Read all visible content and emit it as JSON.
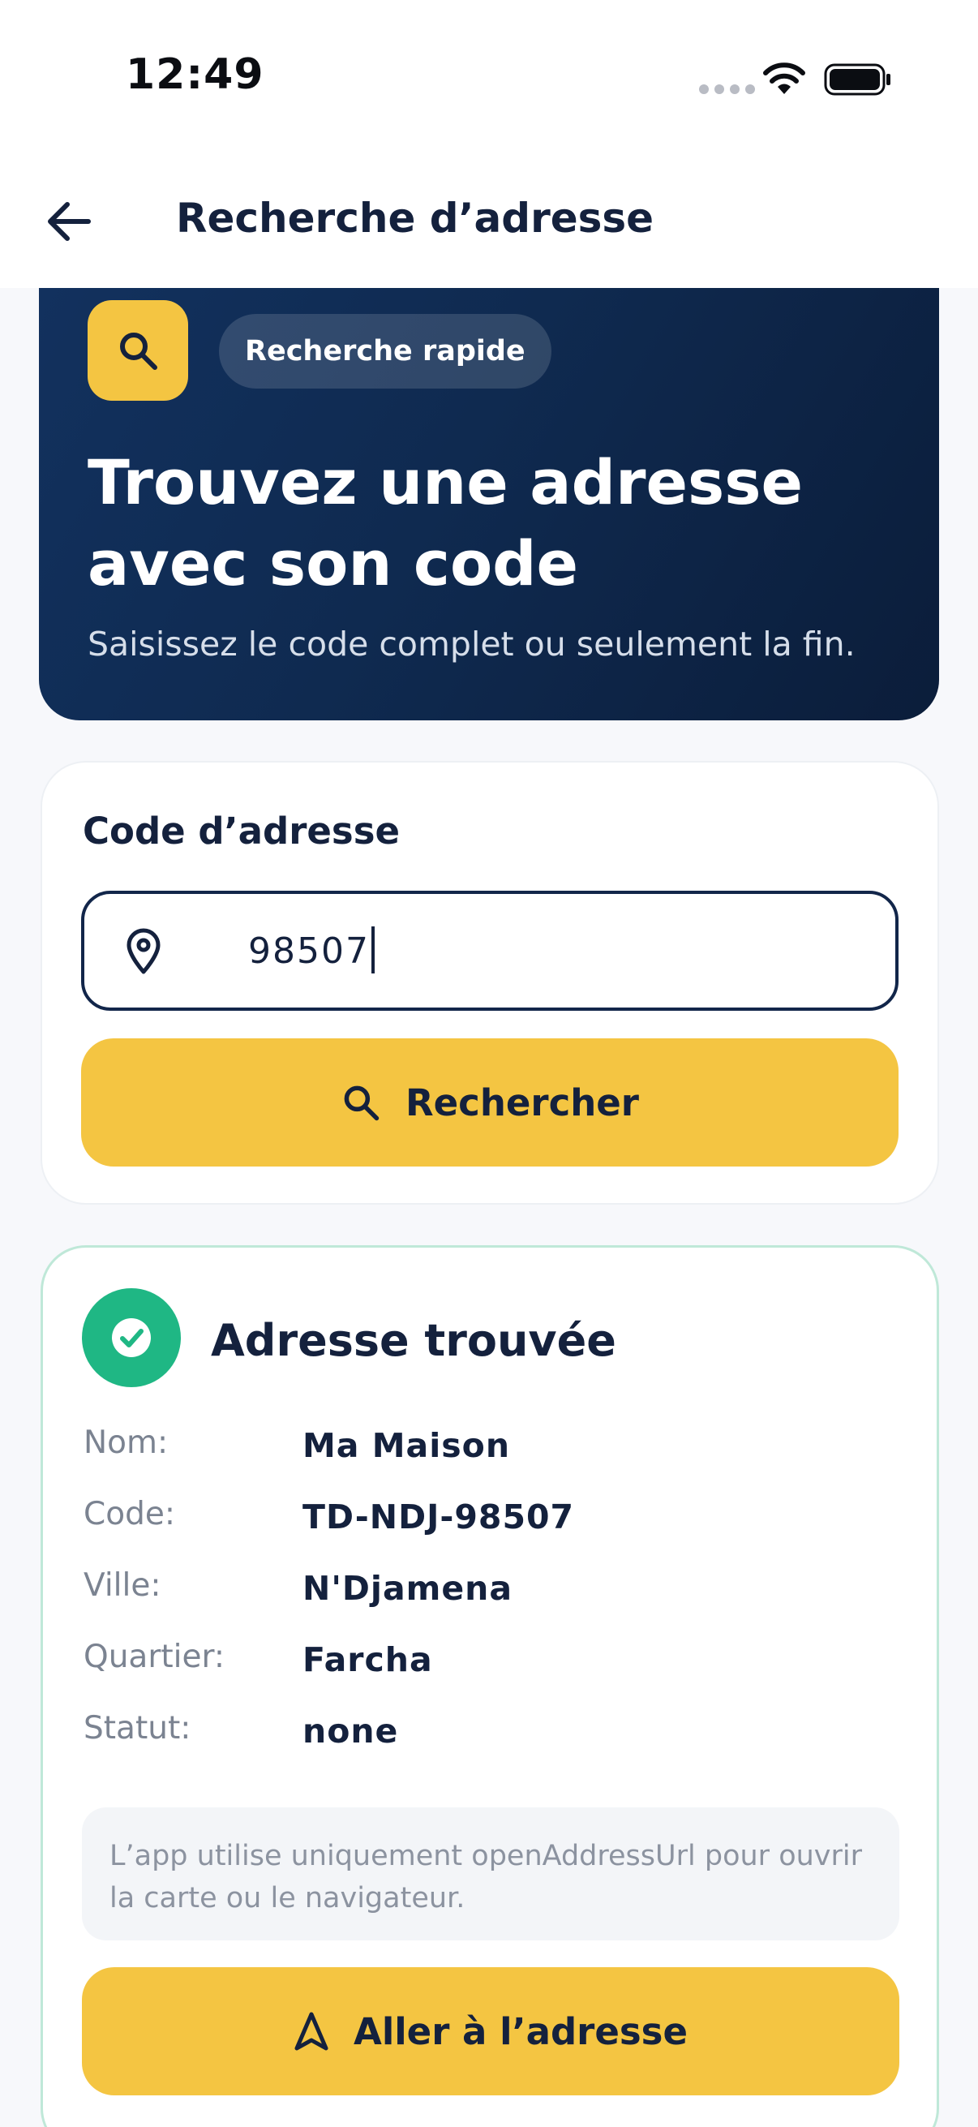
{
  "status_bar": {
    "time": "12:49"
  },
  "header": {
    "title": "Recherche d’adresse",
    "back_icon": "arrow-left-icon"
  },
  "hero": {
    "icon": "search-icon",
    "chip": "Recherche rapide",
    "heading": "Trouvez une adresse avec son code",
    "subtitle": "Saisissez le code complet ou seulement la fin.",
    "colors": {
      "background": "#0f2a50",
      "accent": "#f4c542"
    }
  },
  "search": {
    "label": "Code d’adresse",
    "input_value": "98507",
    "input_icon": "map-pin-icon",
    "button_label": "Rechercher",
    "button_icon": "search-icon"
  },
  "result": {
    "title": "Adresse trouvée",
    "icon": "check-circle-icon",
    "fields": [
      {
        "label": "Nom:",
        "value": "Ma Maison"
      },
      {
        "label": "Code:",
        "value": "TD-NDJ-98507"
      },
      {
        "label": "Ville:",
        "value": "N'Djamena"
      },
      {
        "label": "Quartier:",
        "value": "Farcha"
      },
      {
        "label": "Statut:",
        "value": "none"
      }
    ],
    "note": "L’app utilise uniquement openAddressUrl pour ouvrir la carte ou le navigateur.",
    "button_label": "Aller à l’adresse",
    "button_icon": "navigation-arrow-icon",
    "colors": {
      "success": "#1fb784",
      "border": "#bfe8d8"
    }
  }
}
